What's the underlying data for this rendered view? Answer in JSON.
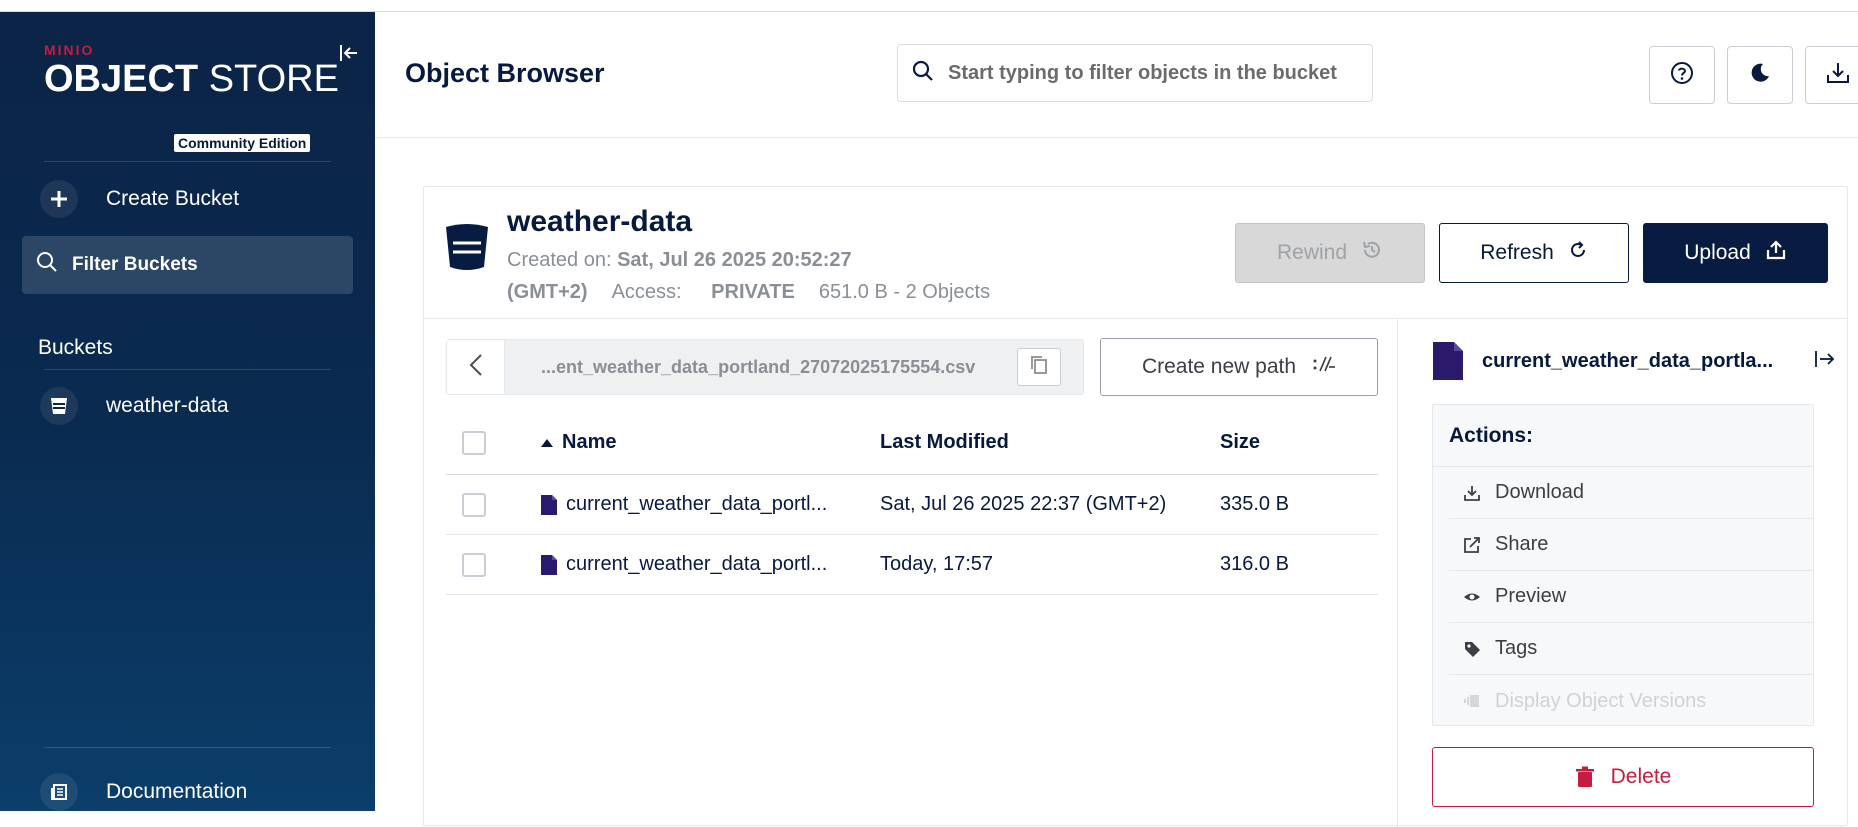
{
  "sidebar": {
    "brand_top": "MINIO",
    "brand_bold": "OBJECT",
    "brand_light": " STORE",
    "brand_edition": "Community Edition",
    "create_bucket": "Create Bucket",
    "filter_buckets": "Filter Buckets",
    "buckets_label": "Buckets",
    "bucket_item": "weather-data",
    "documentation": "Documentation"
  },
  "header": {
    "title": "Object Browser",
    "search_placeholder": "Start typing to filter objects in the bucket"
  },
  "bucket": {
    "name": "weather-data",
    "created_label": "Created on:",
    "created_value": "Sat, Jul 26 2025 20:52:27",
    "timezone": "(GMT+2)",
    "access_label": "Access:",
    "access_value": "PRIVATE",
    "usage": "651.0 B - 2 Objects",
    "rewind": "Rewind",
    "refresh": "Refresh",
    "upload": "Upload"
  },
  "browser": {
    "path": "...ent_weather_data_portland_27072025175554.csv",
    "create_new_path": "Create new path",
    "columns": {
      "name": "Name",
      "modified": "Last Modified",
      "size": "Size"
    },
    "rows": [
      {
        "name": "current_weather_data_portl...",
        "modified": "Sat, Jul 26 2025 22:37 (GMT+2)",
        "size": "335.0 B"
      },
      {
        "name": "current_weather_data_portl...",
        "modified": "Today, 17:57",
        "size": "316.0 B"
      }
    ]
  },
  "details": {
    "title": "current_weather_data_portla...",
    "actions_label": "Actions:",
    "download": "Download",
    "share": "Share",
    "preview": "Preview",
    "tags": "Tags",
    "versions": "Display Object Versions",
    "delete": "Delete"
  },
  "colors": {
    "navy": "#081c42",
    "accent_red": "#c51c3f",
    "file_purple": "#2b1a6b",
    "status_green": "#4ccb8d"
  }
}
